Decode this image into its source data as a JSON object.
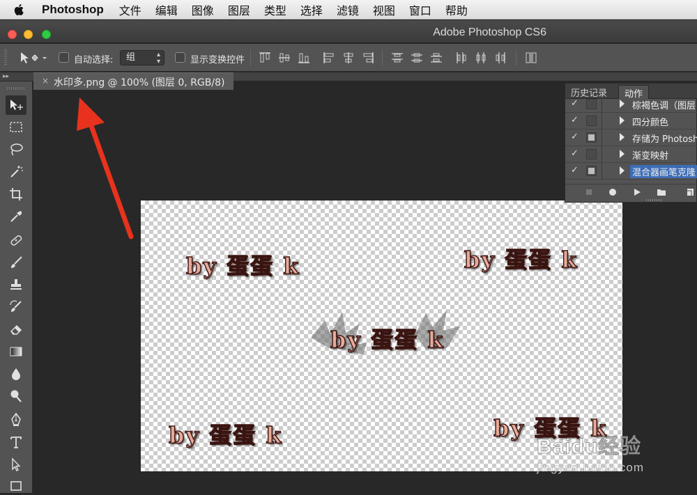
{
  "menubar": {
    "app_name": "Photoshop",
    "items": [
      "文件",
      "编辑",
      "图像",
      "图层",
      "类型",
      "选择",
      "滤镜",
      "视图",
      "窗口",
      "帮助"
    ]
  },
  "window": {
    "title": "Adobe Photoshop CS6"
  },
  "options_bar": {
    "auto_select_label": "自动选择:",
    "auto_select_checked": false,
    "auto_select_target": "组",
    "show_transform_label": "显示变换控件",
    "show_transform_checked": false
  },
  "document": {
    "tab_close": "×",
    "tab_title": "水印多.png @ 100% (图层 0, RGB/8)",
    "watermark_text": "by 蛋蛋 k"
  },
  "actions_panel": {
    "tabs": [
      "历史记录",
      "动作"
    ],
    "active_tab": "动作",
    "rows": [
      {
        "label": "棕褐色调（图层",
        "checked": true,
        "dialog": false,
        "selected": false
      },
      {
        "label": "四分颜色",
        "checked": true,
        "dialog": false,
        "selected": false
      },
      {
        "label": "存储为 Photosh",
        "checked": true,
        "dialog": true,
        "selected": false
      },
      {
        "label": "渐变映射",
        "checked": true,
        "dialog": false,
        "selected": false
      },
      {
        "label": "混合器画笔克隆",
        "checked": true,
        "dialog": true,
        "selected": true
      }
    ],
    "check_glyph": "✓"
  },
  "baidu_watermark": {
    "text": "Baidu经验",
    "url": "jingyan.baidu.com"
  },
  "colors": {
    "accent_selected": "#3d6db5",
    "arrow": "#e8321e",
    "canvas_bg": "#282828"
  }
}
